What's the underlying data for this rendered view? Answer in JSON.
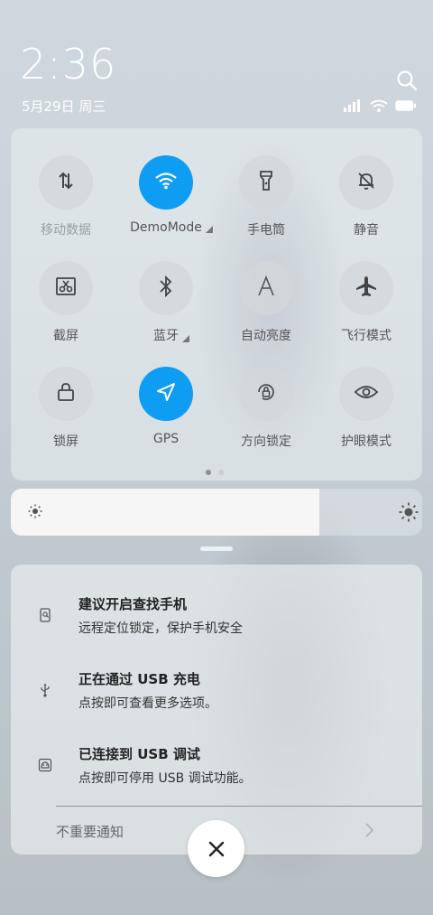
{
  "status": {
    "time": "2:36",
    "date": "5月29日 周三",
    "icons": [
      "signal-icon",
      "wifi-icon",
      "battery-icon"
    ]
  },
  "quick_settings": {
    "tiles": [
      {
        "label": "移动数据",
        "icon": "mobile-data-icon",
        "active": false,
        "dim": true
      },
      {
        "label": "DemoMode",
        "icon": "wifi-icon",
        "active": true,
        "has_more": true
      },
      {
        "label": "手电筒",
        "icon": "flashlight-icon",
        "active": false
      },
      {
        "label": "静音",
        "icon": "mute-icon",
        "active": false
      },
      {
        "label": "截屏",
        "icon": "screenshot-icon",
        "active": false
      },
      {
        "label": "蓝牙",
        "icon": "bluetooth-icon",
        "active": false,
        "has_more": true
      },
      {
        "label": "自动亮度",
        "icon": "auto-brightness-icon",
        "active": false
      },
      {
        "label": "飞行模式",
        "icon": "airplane-icon",
        "active": false
      },
      {
        "label": "锁屏",
        "icon": "lock-icon",
        "active": false
      },
      {
        "label": "GPS",
        "icon": "gps-icon",
        "active": true
      },
      {
        "label": "方向锁定",
        "icon": "rotation-lock-icon",
        "active": false
      },
      {
        "label": "护眼模式",
        "icon": "eye-icon",
        "active": false
      }
    ],
    "page_count": 2,
    "current_page": 1
  },
  "brightness": {
    "level": 0.75
  },
  "notifications": [
    {
      "title": "建议开启查找手机",
      "subtitle": "远程定位锁定，保护手机安全",
      "icon": "find-phone-icon"
    },
    {
      "title": "正在通过 USB 充电",
      "subtitle": "点按即可查看更多选项。",
      "icon": "usb-icon"
    },
    {
      "title": "已连接到 USB 调试",
      "subtitle": "点按即可停用 USB 调试功能。",
      "icon": "android-debug-icon"
    }
  ],
  "unimportant_label": "不重要通知",
  "colors": {
    "accent": "#0f9df4"
  }
}
